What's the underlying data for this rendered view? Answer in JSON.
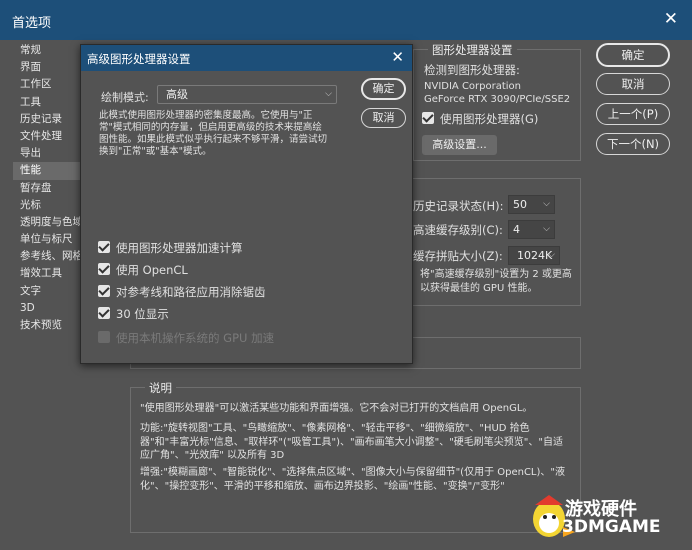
{
  "window": {
    "title": "首选项"
  },
  "sidebar": {
    "items": [
      {
        "label": "常规"
      },
      {
        "label": "界面"
      },
      {
        "label": "工作区"
      },
      {
        "label": "工具"
      },
      {
        "label": "历史记录"
      },
      {
        "label": "文件处理"
      },
      {
        "label": "导出"
      },
      {
        "label": "性能"
      },
      {
        "label": "暂存盘"
      },
      {
        "label": "光标"
      },
      {
        "label": "透明度与色域"
      },
      {
        "label": "单位与标尺"
      },
      {
        "label": "参考线、网格和切片"
      },
      {
        "label": "增效工具"
      },
      {
        "label": "文字"
      },
      {
        "label": "3D"
      },
      {
        "label": "技术预览"
      }
    ],
    "active_index": 7
  },
  "buttons": {
    "ok": "确定",
    "cancel": "取消",
    "prev": "上一个(P)",
    "next": "下一个(N)"
  },
  "gpu_group": {
    "title": "图形处理器设置",
    "detected_label": "检测到图形处理器:",
    "vendor": "NVIDIA Corporation",
    "model": "GeForce RTX 3090/PCIe/SSE2",
    "use_gpu_label": "使用图形处理器(G)",
    "advanced_button": "高级设置..."
  },
  "history_cache": {
    "history_states_label": "历史记录状态(H):",
    "history_states_value": "50",
    "cache_levels_label": "高速缓存级别(C):",
    "cache_levels_value": "4",
    "tile_size_label": "缓存拼贴大小(Z):",
    "tile_size_value": "1024K",
    "note": "将\"高速缓存级别\"设置为 2 或更高以获得最佳的 GPU 性能。"
  },
  "description": {
    "title": "说明",
    "p1": "\"使用图形处理器\"可以激活某些功能和界面增强。它不会对已打开的文档启用 OpenGL。",
    "p2": "功能:\"旋转视图\"工具、\"鸟瞰缩放\"、\"像素网格\"、\"轻击平移\"、\"细微缩放\"、\"HUD 拾色器\"和\"丰富光标\"信息、\"取样环\"(\"吸管工具\")、\"画布画笔大小调整\"、\"硬毛刷笔尖预览\"、\"自适应广角\"、\"光效库\" 以及所有 3D",
    "p3": "增强:\"模糊画廊\"、\"智能锐化\"、\"选择焦点区域\"、\"图像大小与保留细节\"(仅用于 OpenCL)、\"液化\"、\"操控变形\"、平滑的平移和缩放、画布边界投影、\"绘画\"性能、\"变换\"/\"变形\""
  },
  "dialog": {
    "title": "高级图形处理器设置",
    "mode_label": "绘制模式:",
    "mode_value": "高级",
    "ok": "确定",
    "cancel": "取消",
    "mode_description": "此模式使用图形处理器的密集度最高。它使用与\"正常\"模式相同的内存量，但启用更高级的技术来提高绘图性能。如果此模式似乎执行起来不够平滑，请尝试切换到\"正常\"或\"基本\"模式。",
    "options": [
      {
        "label": "使用图形处理器加速计算",
        "checked": true,
        "enabled": true
      },
      {
        "label": "使用 OpenCL",
        "checked": true,
        "enabled": true
      },
      {
        "label": "对参考线和路径应用消除锯齿",
        "checked": true,
        "enabled": true
      },
      {
        "label": "30 位显示",
        "checked": true,
        "enabled": true
      },
      {
        "label": "使用本机操作系统的 GPU 加速",
        "checked": false,
        "enabled": false
      }
    ]
  },
  "watermark": {
    "line1": "游戏硬件",
    "line2": "3DMGAME"
  }
}
